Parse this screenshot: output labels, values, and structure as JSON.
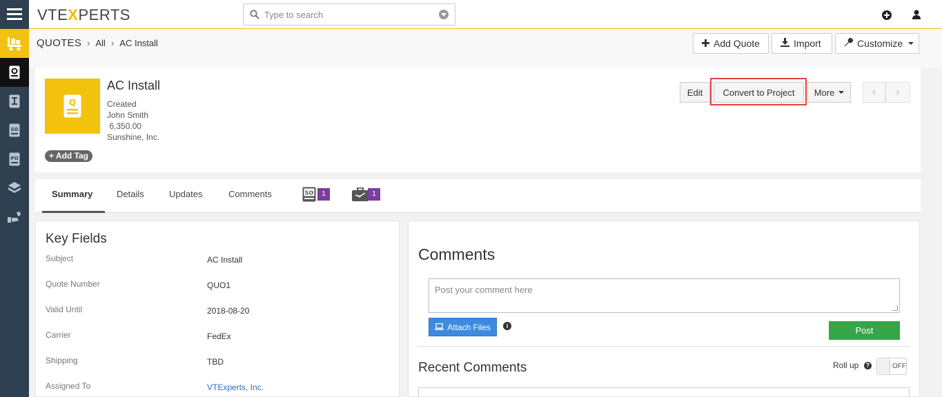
{
  "topbar": {
    "logo_main": "VTE",
    "logo_x": "X",
    "logo_rest": "PERTS",
    "search_placeholder": "Type to search"
  },
  "sidebar": {
    "items": [
      {
        "icon": "hamburger-menu-icon"
      },
      {
        "icon": "inventory-icon"
      },
      {
        "icon": "quotes-icon"
      },
      {
        "icon": "invoice-icon"
      },
      {
        "icon": "sales-order-icon"
      },
      {
        "icon": "purchase-order-icon"
      },
      {
        "icon": "products-icon"
      },
      {
        "icon": "services-icon"
      }
    ]
  },
  "breadcrumb": {
    "module": "QUOTES",
    "filter": "All",
    "record": "AC Install"
  },
  "header_buttons": {
    "add_quote": "Add Quote",
    "import": "Import",
    "customize": "Customize"
  },
  "record": {
    "title": "AC Install",
    "status": "Created",
    "owner": "John Smith",
    "amount": " 6,350.00",
    "organization": "Sunshine, Inc.",
    "add_tag": "Add Tag",
    "icon_letter": "Q"
  },
  "record_buttons": {
    "edit": "Edit",
    "convert": "Convert to Project",
    "more": "More"
  },
  "tabs": {
    "summary": "Summary",
    "details": "Details",
    "updates": "Updates",
    "comments": "Comments",
    "so_badge": "1",
    "project_badge": "1"
  },
  "key_fields": {
    "title": "Key Fields",
    "rows": [
      {
        "label": "Subject",
        "value": "AC Install"
      },
      {
        "label": "Quote Number",
        "value": "QUO1"
      },
      {
        "label": "Valid Until",
        "value": "2018-08-20"
      },
      {
        "label": "Carrier",
        "value": "FedEx"
      },
      {
        "label": "Shipping",
        "value": "TBD"
      },
      {
        "label": "Assigned To",
        "value": "VTExperts, Inc."
      }
    ]
  },
  "comments": {
    "title": "Comments",
    "placeholder": "Post your comment here",
    "attach_label": "Attach Files",
    "post_label": "Post",
    "recent_title": "Recent Comments",
    "rollup_label": "Roll up",
    "toggle_label": "OFF"
  },
  "colors": {
    "accent_yellow": "#f3c20e",
    "sidebar": "#2f4050",
    "highlight_red": "#e0413e",
    "post_green": "#35a548",
    "attach_blue": "#3d8be0",
    "badge_purple": "#7a3d9c"
  }
}
